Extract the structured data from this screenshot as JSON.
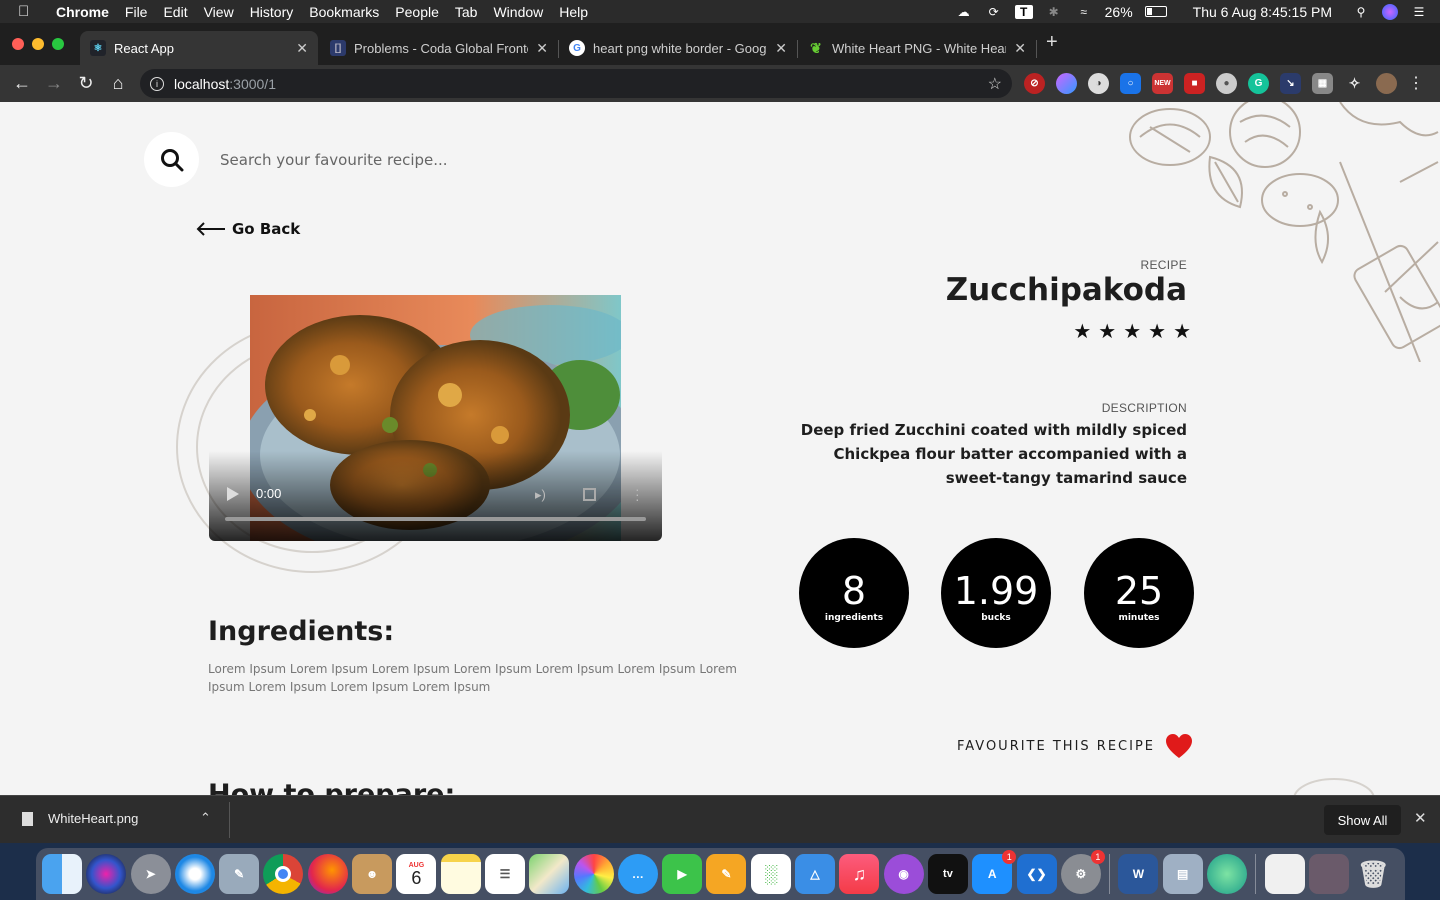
{
  "menubar": {
    "app_name": "Chrome",
    "items": [
      "File",
      "Edit",
      "View",
      "History",
      "Bookmarks",
      "People",
      "Tab",
      "Window",
      "Help"
    ],
    "battery": "26%",
    "clock": "Thu 6 Aug  8:45:15 PM"
  },
  "tabs": [
    {
      "title": "React App",
      "favicon": "react-icon",
      "active": true
    },
    {
      "title": "Problems - Coda Global Fronte",
      "favicon": "coda-icon",
      "active": false
    },
    {
      "title": "heart png white border - Goog",
      "favicon": "google-icon",
      "active": false
    },
    {
      "title": "White Heart PNG - White Heart",
      "favicon": "leaf-icon",
      "active": false
    }
  ],
  "address_bar": {
    "host": "localhost",
    "path": ":3000/1"
  },
  "page": {
    "search_placeholder": "Search your favourite recipe...",
    "go_back": "Go Back",
    "video_time": "0:00",
    "recipe_label": "RECIPE",
    "recipe_title": "Zucchipakoda",
    "rating_stars": 5,
    "description_label": "DESCRIPTION",
    "description": "Deep fried Zucchini coated with mildly spiced Chickpea flour batter accompanied with a sweet-tangy tamarind sauce",
    "stats": [
      {
        "value": "8",
        "unit": "ingredients"
      },
      {
        "value": "1.99",
        "unit": "bucks"
      },
      {
        "value": "25",
        "unit": "minutes"
      }
    ],
    "ingredients_title": "Ingredients:",
    "ingredients_text": "Lorem Ipsum Lorem Ipsum Lorem Ipsum Lorem Ipsum Lorem Ipsum Lorem Ipsum Lorem Ipsum Lorem Ipsum Lorem Ipsum Lorem Ipsum",
    "how_title": "How to prepare:",
    "favourite_label": "FAVOURITE THIS RECIPE",
    "heart_color": "#e01a1a"
  },
  "download_shelf": {
    "filename": "WhiteHeart.png",
    "show_all": "Show All"
  },
  "dock": {
    "calendar_month": "AUG",
    "calendar_day": "6",
    "badge_count": "1"
  }
}
